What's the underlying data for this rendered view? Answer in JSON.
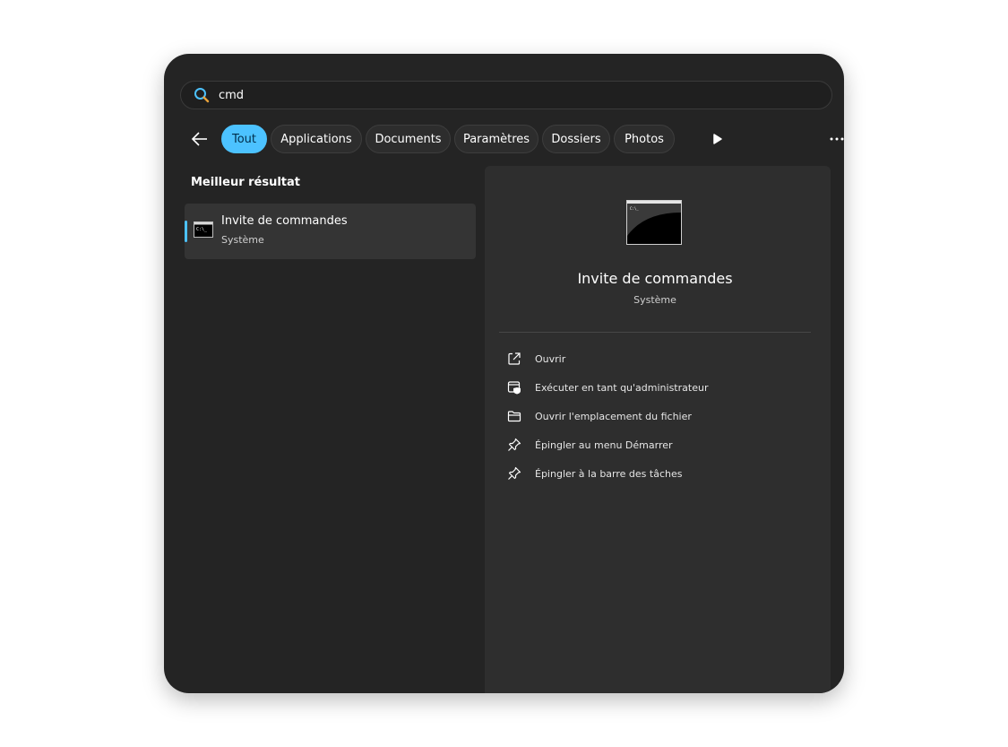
{
  "search": {
    "value": "cmd",
    "icon": "search-icon"
  },
  "filters": {
    "back_icon": "back-arrow-icon",
    "chips": [
      {
        "label": "Tout",
        "active": true
      },
      {
        "label": "Applications",
        "active": false
      },
      {
        "label": "Documents",
        "active": false
      },
      {
        "label": "Paramètres",
        "active": false
      },
      {
        "label": "Dossiers",
        "active": false
      },
      {
        "label": "Photos",
        "active": false
      }
    ],
    "more_icon": "play-icon",
    "overflow_icon": "more-dots-icon"
  },
  "results": {
    "heading": "Meilleur résultat",
    "best": {
      "title": "Invite de commandes",
      "subtitle": "Système",
      "icon": "command-prompt-icon"
    }
  },
  "detail": {
    "title": "Invite de commandes",
    "subtitle": "Système",
    "icon": "command-prompt-icon",
    "actions": [
      {
        "label": "Ouvrir",
        "icon": "open-external-icon"
      },
      {
        "label": "Exécuter en tant qu'administrateur",
        "icon": "admin-shield-icon"
      },
      {
        "label": "Ouvrir l'emplacement du fichier",
        "icon": "folder-icon"
      },
      {
        "label": "Épingler au menu Démarrer",
        "icon": "pin-icon"
      },
      {
        "label": "Épingler à la barre des tâches",
        "icon": "pin-icon"
      }
    ]
  },
  "colors": {
    "accent": "#4cc2ff",
    "background": "#242424",
    "panel": "#2e2e2e"
  }
}
